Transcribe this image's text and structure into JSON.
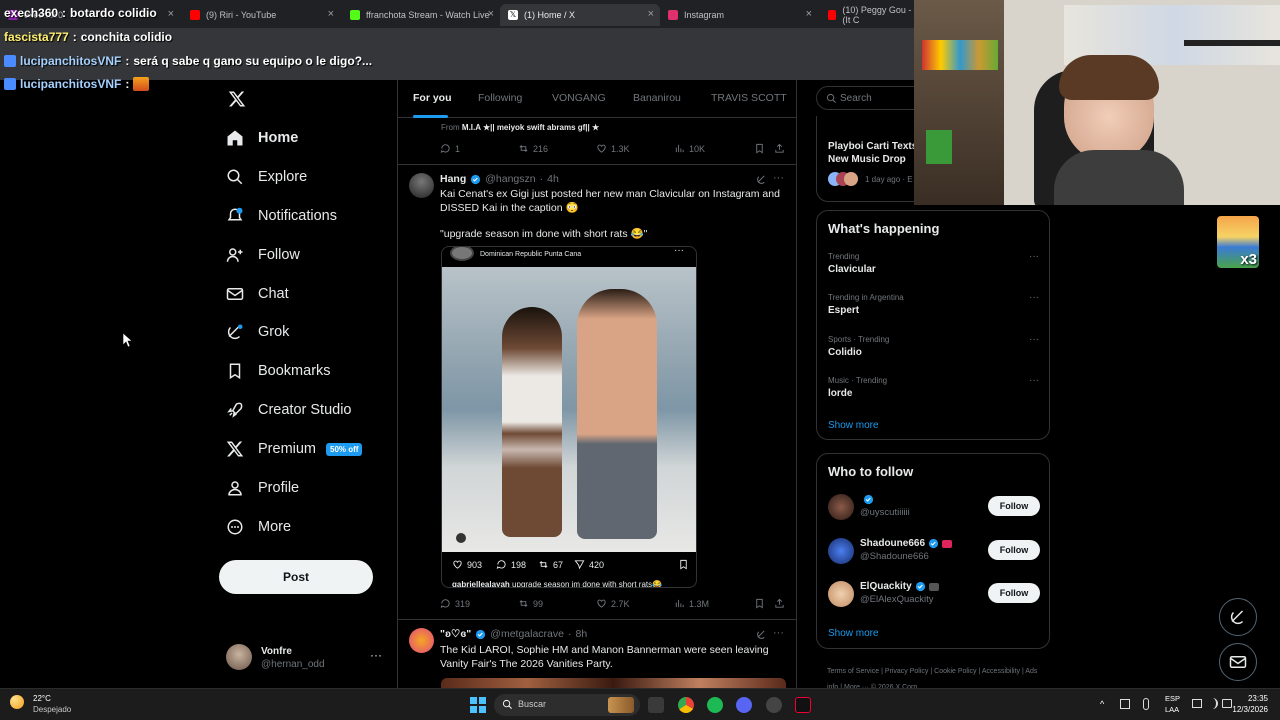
{
  "browser": {
    "tabs": [
      {
        "label": "exech360",
        "color": "#8e24aa"
      },
      {
        "label": "(9) Riri - YouTube",
        "color": "#ff0000"
      },
      {
        "label": "ffranchota Stream - Watch Live",
        "color": "#53fc18"
      },
      {
        "label": "(1) Home / X",
        "color": "#ffffff"
      },
      {
        "label": "Instagram",
        "color": "#e1306c"
      },
      {
        "label": "(10) Peggy Gou - (It C",
        "color": "#ff0000"
      }
    ]
  },
  "stream_chat": [
    {
      "user": "exech360",
      "message": "botardo colidio"
    },
    {
      "user": "fascista777",
      "message": "conchita colidio"
    },
    {
      "user": "lucipanchitosVNF",
      "message": "será q sabe q gano su equipo o le digo?..."
    },
    {
      "user": "lucipanchitosVNF",
      "message": ""
    }
  ],
  "nav": {
    "items": [
      {
        "label": "Home",
        "icon": "home-icon"
      },
      {
        "label": "Explore",
        "icon": "search-icon"
      },
      {
        "label": "Notifications",
        "icon": "bell-icon"
      },
      {
        "label": "Follow",
        "icon": "person-add-icon"
      },
      {
        "label": "Chat",
        "icon": "mail-icon"
      },
      {
        "label": "Grok",
        "icon": "grok-icon"
      },
      {
        "label": "Bookmarks",
        "icon": "bookmark-icon"
      },
      {
        "label": "Creator Studio",
        "icon": "rocket-icon"
      },
      {
        "label": "Premium",
        "icon": "x-logo-icon"
      },
      {
        "label": "Profile",
        "icon": "person-icon"
      },
      {
        "label": "More",
        "icon": "more-circle-icon"
      }
    ],
    "premium_badge": "50% off",
    "post_label": "Post",
    "account": {
      "name": "Vonfre",
      "handle": "@hernan_odd"
    }
  },
  "feed": {
    "tabs": [
      "For you",
      "Following",
      "VONGANG",
      "Bananirou",
      "TRAVIS SCOTT"
    ],
    "prev_tweet": {
      "from_label": "From",
      "from_text": "M.I.A ★|| meiyok swift abrams gf|| ★",
      "stats": {
        "replies": "1",
        "reposts": "216",
        "likes": "1.3K",
        "views": "10K"
      }
    },
    "tweet": {
      "name": "Hang",
      "handle": "@hangszn",
      "time": "4h",
      "text1": "Kai Cenat's ex Gigi just posted her new man Clavicular on Instagram and DISSED Kai in the caption 😳",
      "text2": "\"upgrade season im done with short rats 😂\"",
      "embed": {
        "location": "Dominican Republic Punta Cana",
        "likes": "903",
        "comments": "198",
        "reposts": "67",
        "shares": "420",
        "caption_user": "gabriellealayah",
        "caption": "upgrade season im done with short rats😂"
      },
      "stats": {
        "replies": "319",
        "reposts": "99",
        "likes": "2.7K",
        "views": "1.3M"
      }
    },
    "next_tweet": {
      "name": "\"ʚ♡ɞ\"",
      "handle": "@metgalacrave",
      "time": "8h",
      "text": "The Kid LAROI, Sophie HM and Manon Bannerman were seen leaving Vanity Fair's The 2026 Vanities Party."
    }
  },
  "right": {
    "search_placeholder": "Search",
    "top_card": {
      "title": "Playboi Carti Texts New Music Drop",
      "meta": "1 day ago · E"
    },
    "happening": {
      "title": "What's happening",
      "trends": [
        {
          "meta": "Trending",
          "name": "Clavicular"
        },
        {
          "meta": "Trending in Argentina",
          "name": "Espert"
        },
        {
          "meta": "Sports · Trending",
          "name": "Colidio"
        },
        {
          "meta": "Music · Trending",
          "name": "lorde"
        }
      ],
      "show_more": "Show more"
    },
    "who_to_follow": {
      "title": "Who to follow",
      "accounts": [
        {
          "name": "",
          "handle": "@uyscutiiiiii",
          "follow": "Follow"
        },
        {
          "name": "Shadoune666",
          "handle": "@Shadoune666",
          "follow": "Follow"
        },
        {
          "name": "ElQuackity",
          "handle": "@ElAlexQuackity",
          "follow": "Follow"
        }
      ],
      "show_more": "Show more"
    },
    "footer": [
      "Terms of Service",
      "Privacy Policy",
      "Cookie Policy",
      "Accessibility",
      "Ads info",
      "More ···",
      "© 2026 X Corp."
    ]
  },
  "overlay": {
    "multiplier": "x3"
  },
  "taskbar": {
    "weather_temp": "22°C",
    "weather_desc": "Despejado",
    "search_label": "Buscar",
    "lang": "ESP",
    "lang2": "LAA",
    "time": "23:35",
    "date": "12/3/2026"
  }
}
